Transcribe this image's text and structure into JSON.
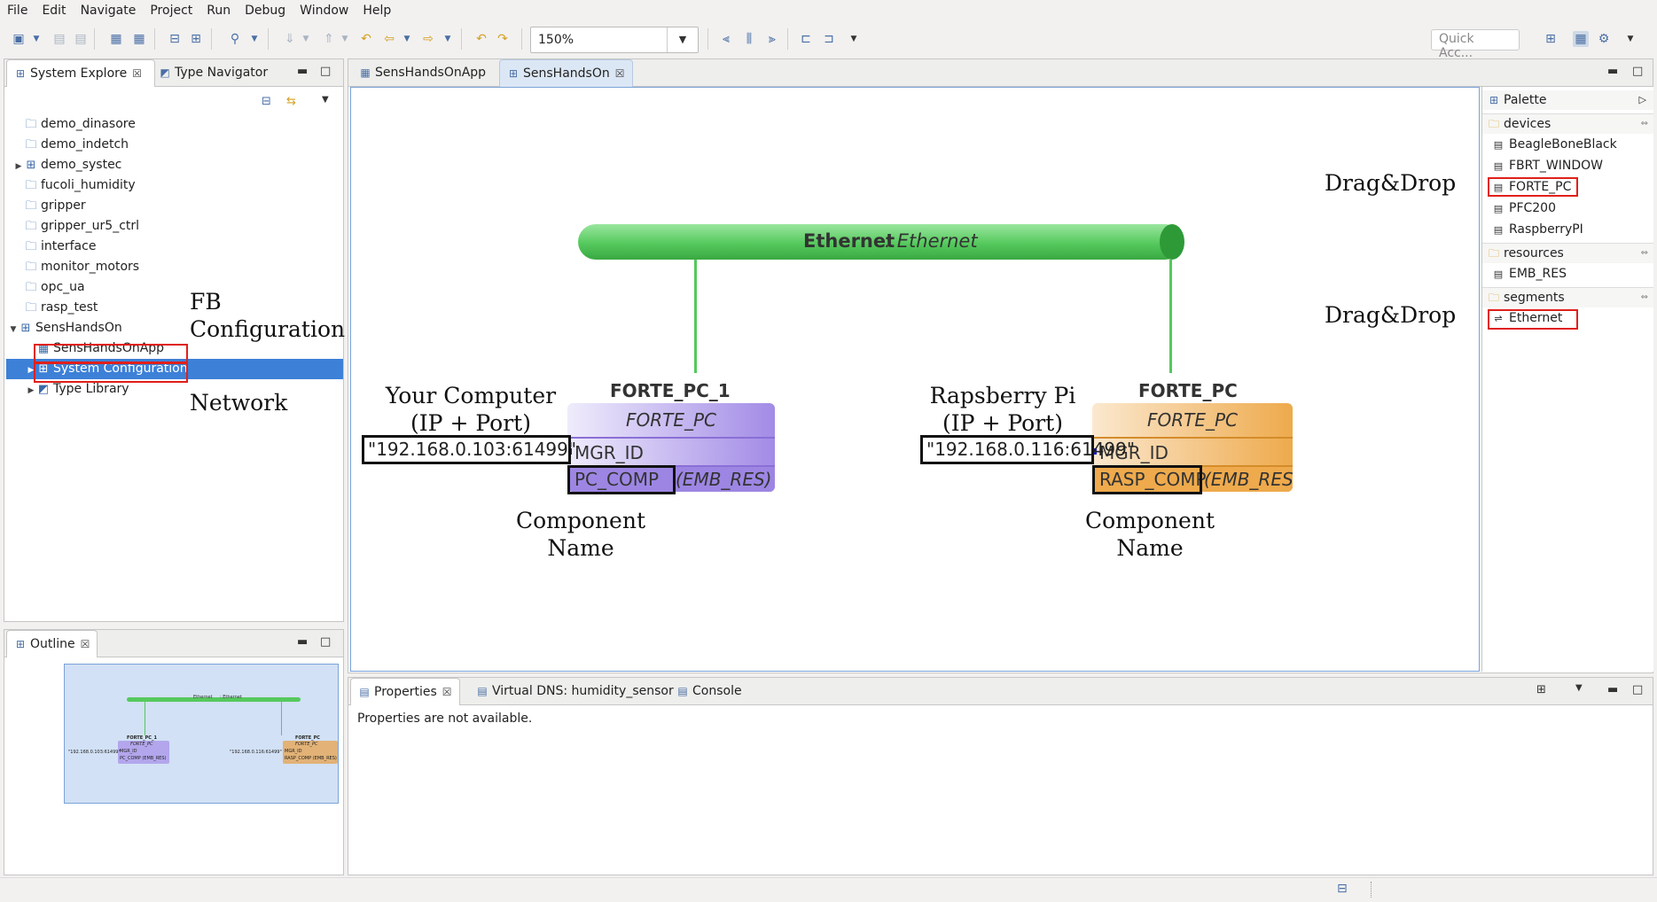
{
  "menu": [
    "File",
    "Edit",
    "Navigate",
    "Project",
    "Run",
    "Debug",
    "Window",
    "Help"
  ],
  "toolbar": {
    "zoom": "150%",
    "quick_access_placeholder": "Quick Acc..."
  },
  "left_panel": {
    "tabs": [
      "System Explore",
      "Type Navigator"
    ],
    "tree": [
      {
        "label": "demo_dinasore"
      },
      {
        "label": "demo_indetch"
      },
      {
        "label": "demo_systec"
      },
      {
        "label": "fucoli_humidity"
      },
      {
        "label": "gripper"
      },
      {
        "label": "gripper_ur5_ctrl"
      },
      {
        "label": "interface"
      },
      {
        "label": "monitor_motors"
      },
      {
        "label": "opc_ua"
      },
      {
        "label": "rasp_test"
      },
      {
        "label": "SensHandsOn"
      },
      {
        "label": "SensHandsOnApp"
      },
      {
        "label": "System Configuration"
      },
      {
        "label": "Type Library"
      }
    ],
    "annotations": {
      "fb": "FB\nConfiguration",
      "network": "Network"
    }
  },
  "outline": {
    "tab": "Outline",
    "mini": {
      "ethernet": "Ethernet",
      "ethernet_type": ": Ethernet",
      "dev1": "FORTE_PC_1",
      "dev2": "FORTE_PC",
      "type": "FORTE_PC",
      "mgr": "MGR_ID",
      "ip1": "\"192.168.0.103:61499\"",
      "ip2": "\"192.168.0.116:61499\"",
      "comp1": "PC_COMP (EMB_RES)",
      "comp2": "RASP_COMP (EMB_RES)"
    }
  },
  "editor": {
    "tabs": [
      "SensHandsOnApp",
      "SensHandsOn"
    ],
    "segment": {
      "name": "Ethernet",
      "type": ": Ethernet"
    },
    "drag1": "Drag&Drop",
    "drag2": "Drag&Drop",
    "devices": [
      {
        "name": "FORTE_PC_1",
        "type": "FORTE_PC",
        "param": "MGR_ID",
        "resource": "PC_COMP",
        "resource_type": "(EMB_RES)",
        "ip": "\"192.168.0.103:61499\"",
        "label": "Your Computer\n(IP + Port)",
        "comp_label": "Component\nName",
        "color": "#a28be6"
      },
      {
        "name": "FORTE_PC",
        "type": "FORTE_PC",
        "param": "MGR_ID",
        "resource": "RASP_COMP",
        "resource_type": "(EMB_RES)",
        "ip": "\"192.168.0.116:61499\"",
        "label": "Rapsberry Pi\n(IP + Port)",
        "comp_label": "Component\nName",
        "color": "#eeaa4c"
      }
    ]
  },
  "palette": {
    "title": "Palette",
    "groups": [
      {
        "name": "devices",
        "items": [
          "BeagleBoneBlack",
          "FBRT_WINDOW",
          "FORTE_PC",
          "PFC200",
          "RaspberryPI"
        ]
      },
      {
        "name": "resources",
        "items": [
          "EMB_RES"
        ]
      },
      {
        "name": "segments",
        "items": [
          "Ethernet"
        ]
      }
    ]
  },
  "bottom": {
    "tabs": [
      "Properties",
      "Virtual DNS: humidity_sensor",
      "Console"
    ],
    "message": "Properties are not available."
  },
  "colors": {
    "accent": "#3d80d7",
    "ethernet": "#55c95d",
    "device1": "#a28be6",
    "device2": "#eeaa4c",
    "highlight": "#e0201a"
  }
}
